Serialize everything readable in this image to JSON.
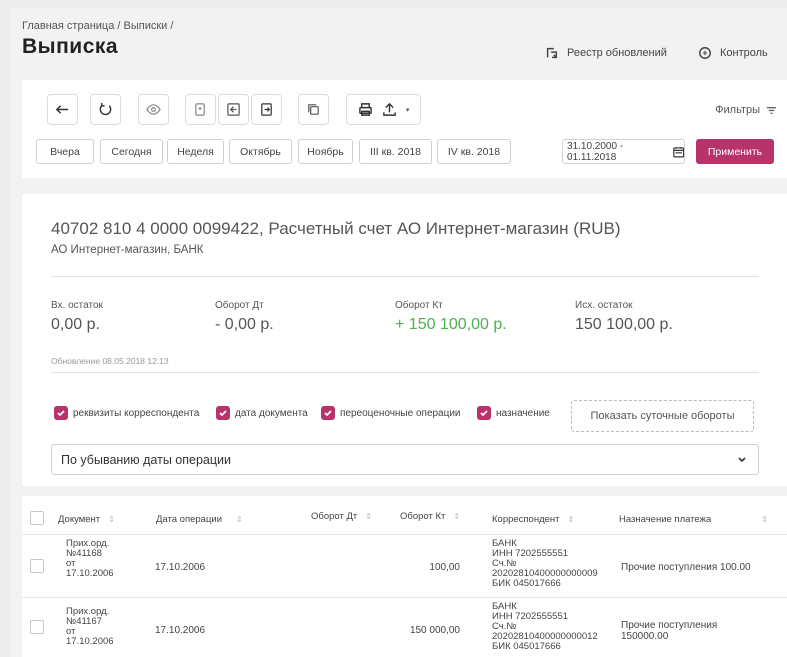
{
  "header": {
    "breadcrumb": "Главная страница / Выписки /",
    "title": "Выписка",
    "links": [
      {
        "label": "Реестр обновлений",
        "icon": "refresh-registry-icon"
      },
      {
        "label": "Контроль",
        "icon": "control-icon"
      }
    ]
  },
  "toolbar": {
    "filters_label": "Фильтры",
    "periods": [
      "Вчера",
      "Сегодня",
      "Неделя",
      "Октябрь",
      "Ноябрь",
      "III кв. 2018",
      "IV кв. 2018"
    ],
    "date_range": "31.10.2000 - 01.11.2018",
    "apply_label": "Применить"
  },
  "account": {
    "title": "40702 810 4 0000 0099422, Расчетный счет АО Интернет-магазин (RUB)",
    "subtitle": "АО Интернет-магазин, БАНК",
    "balances": [
      {
        "label": "Вх. остаток",
        "value": "0,00 р."
      },
      {
        "label": "Оборот Дт",
        "value": "- 0,00 р."
      },
      {
        "label": "Оборот Кт",
        "value": "+ 150 100,00 р."
      },
      {
        "label": "Исх. остаток",
        "value": "150 100,00 р."
      }
    ],
    "updated": "Обновление 08.05.2018 12:13",
    "checkboxes": [
      "реквизиты корреспондента",
      "дата документа",
      "переоценочные операции",
      "назначение"
    ],
    "show_daily_label": "Показать суточные обороты",
    "sort_value": "По убыванию даты операции"
  },
  "table": {
    "columns": [
      "Документ",
      "Дата операции",
      "Оборот Дт",
      "Оборот Кт",
      "Корреспондент",
      "Назначение платежа"
    ],
    "rows": [
      {
        "doc": [
          "Прих.орд.",
          "№41168",
          "от",
          "17.10.2006"
        ],
        "date": "17.10.2006",
        "debit": "",
        "credit": "100,00",
        "corr": [
          "БАНК",
          "ИНН 7202555551",
          "Сч.№",
          "20202810400000000009",
          "БИК 045017666"
        ],
        "purpose": [
          "Прочие поступления 100.00"
        ]
      },
      {
        "doc": [
          "Прих.орд.",
          "№41167",
          "от",
          "17.10.2006"
        ],
        "date": "17.10.2006",
        "debit": "",
        "credit": "150 000,00",
        "corr": [
          "БАНК",
          "ИНН 7202555551",
          "Сч.№",
          "20202810400000000012",
          "БИК 045017666"
        ],
        "purpose": [
          "Прочие поступления",
          "150000.00"
        ]
      }
    ]
  },
  "colors": {
    "accent": "#b8336a",
    "positive": "#4caf50"
  }
}
